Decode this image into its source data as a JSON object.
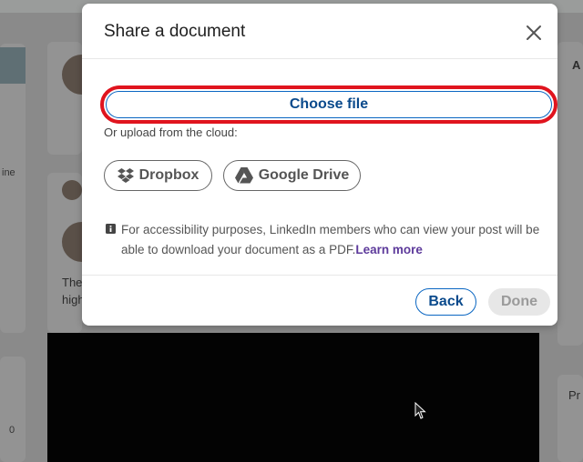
{
  "background": {
    "left_partial_text": "ine",
    "left_partial_number": "0",
    "mid_partial_line1": "The",
    "mid_partial_line2": "high",
    "right_partial_top": "A",
    "right_partial_bottom": "Pr"
  },
  "modal": {
    "title": "Share a document",
    "choose_file_label": "Choose file",
    "cloud_label": "Or upload from the cloud:",
    "dropbox_label": "Dropbox",
    "gdrive_label": "Google Drive",
    "info_text": "For accessibility purposes, LinkedIn members who can view your post will be able to download your document as a PDF.",
    "learn_more_label": "Learn more",
    "back_label": "Back",
    "done_label": "Done"
  },
  "colors": {
    "accent": "#0a66c2",
    "highlight": "#e0141e",
    "link": "#5d3a9b"
  },
  "icons": {
    "close": "close-icon",
    "dropbox": "dropbox-icon",
    "gdrive": "google-drive-icon",
    "info": "info-icon",
    "cursor": "mouse-pointer-icon"
  }
}
